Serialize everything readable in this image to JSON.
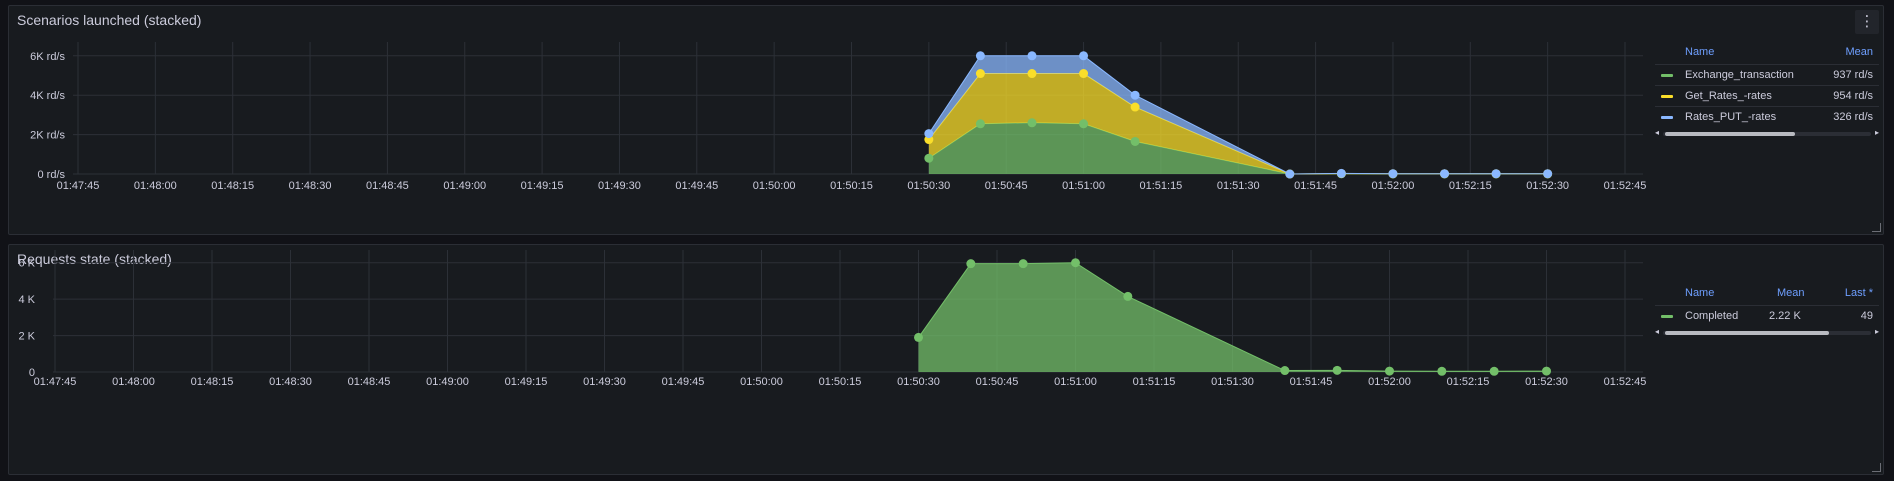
{
  "colors": {
    "green": "#73bf69",
    "yellow": "#fade2a",
    "blue": "#8ab8ff",
    "grid": "#2c3037",
    "text": "#ccccdc",
    "header": "#6e9fff"
  },
  "panels": [
    {
      "title": "Scenarios launched (stacked)",
      "menu_icon": "⋮",
      "legend": {
        "columns": [
          "Name",
          "Mean"
        ],
        "rows": [
          {
            "name": "Exchange_transaction",
            "mean": "937 rd/s",
            "color": "#73bf69"
          },
          {
            "name": "Get_Rates_-rates",
            "mean": "954 rd/s",
            "color": "#fade2a"
          },
          {
            "name": "Rates_PUT_-rates",
            "mean": "326 rd/s",
            "color": "#8ab8ff"
          }
        ]
      }
    },
    {
      "title": "Requests state (stacked)",
      "menu_icon": "",
      "legend": {
        "columns": [
          "Name",
          "Mean",
          "Last *"
        ],
        "rows": [
          {
            "name": "Completed",
            "mean": "2.22 K",
            "last": "49",
            "color": "#73bf69"
          }
        ]
      }
    }
  ],
  "chart_data": [
    {
      "type": "area",
      "title": "Scenarios launched (stacked)",
      "stacked": true,
      "x": [
        "01:50:30",
        "01:50:40",
        "01:50:50",
        "01:51:00",
        "01:51:10",
        "01:51:40",
        "01:51:50",
        "01:52:00",
        "01:52:10",
        "01:52:20",
        "01:52:30"
      ],
      "x_ticks": [
        "01:47:45",
        "01:48:00",
        "01:48:15",
        "01:48:30",
        "01:48:45",
        "01:49:00",
        "01:49:15",
        "01:49:30",
        "01:49:45",
        "01:50:00",
        "01:50:15",
        "01:50:30",
        "01:50:45",
        "01:51:00",
        "01:51:15",
        "01:51:30",
        "01:51:45",
        "01:52:00",
        "01:52:15",
        "01:52:30",
        "01:52:45"
      ],
      "y_ticks": [
        "0 rd/s",
        "2K rd/s",
        "4K rd/s",
        "6K rd/s"
      ],
      "ylim": [
        0,
        6700
      ],
      "series": [
        {
          "name": "Exchange_transaction",
          "color": "#73bf69",
          "values": [
            800,
            2550,
            2600,
            2550,
            1650,
            0,
            10,
            5,
            5,
            5,
            5
          ]
        },
        {
          "name": "Get_Rates_-rates",
          "color": "#fade2a",
          "values": [
            950,
            2550,
            2500,
            2550,
            1750,
            0,
            10,
            5,
            5,
            5,
            5
          ]
        },
        {
          "name": "Rates_PUT_-rates",
          "color": "#8ab8ff",
          "values": [
            300,
            900,
            900,
            900,
            600,
            0,
            10,
            5,
            5,
            5,
            5
          ]
        }
      ]
    },
    {
      "type": "area",
      "title": "Requests state (stacked)",
      "stacked": true,
      "x": [
        "01:50:30",
        "01:50:40",
        "01:50:50",
        "01:51:00",
        "01:51:10",
        "01:51:40",
        "01:51:50",
        "01:52:00",
        "01:52:10",
        "01:52:20",
        "01:52:30"
      ],
      "x_ticks": [
        "01:47:45",
        "01:48:00",
        "01:48:15",
        "01:48:30",
        "01:48:45",
        "01:49:00",
        "01:49:15",
        "01:49:30",
        "01:49:45",
        "01:50:00",
        "01:50:15",
        "01:50:30",
        "01:50:45",
        "01:51:00",
        "01:51:15",
        "01:51:30",
        "01:51:45",
        "01:52:00",
        "01:52:15",
        "01:52:30",
        "01:52:45"
      ],
      "y_ticks": [
        "0",
        "2 K",
        "4 K",
        "6 K"
      ],
      "ylim": [
        0,
        6700
      ],
      "series": [
        {
          "name": "Completed",
          "color": "#73bf69",
          "values": [
            1900,
            5950,
            5950,
            6000,
            4150,
            80,
            90,
            50,
            40,
            40,
            49
          ]
        }
      ]
    }
  ]
}
